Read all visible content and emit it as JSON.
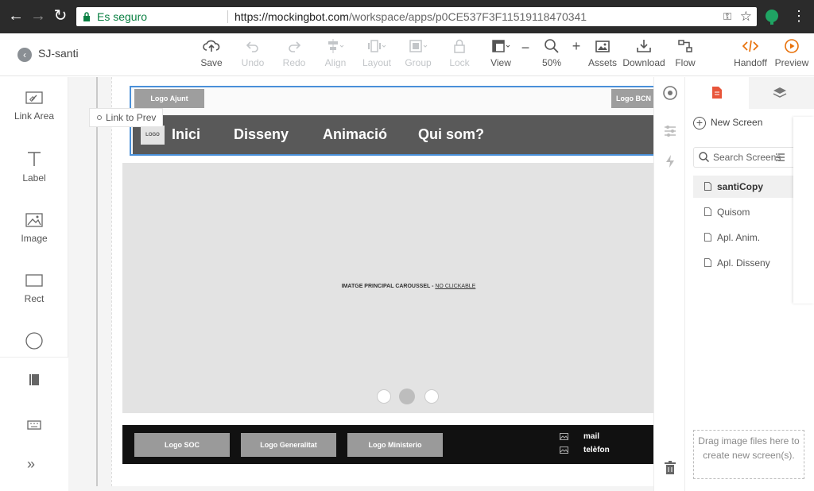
{
  "browser": {
    "secure_label": "Es seguro",
    "url_host": "https://mockingbot.com",
    "url_path": "/workspace/apps/p0CE537F3F11519118470341"
  },
  "toolbar": {
    "project_name": "SJ-santi",
    "save": "Save",
    "undo": "Undo",
    "redo": "Redo",
    "align": "Align",
    "layout": "Layout",
    "group": "Group",
    "lock": "Lock",
    "view": "View",
    "zoom": "50%",
    "assets": "Assets",
    "download": "Download",
    "flow": "Flow",
    "handoff": "Handoff",
    "preview": "Preview"
  },
  "widgets": {
    "link_area": "Link Area",
    "label": "Label",
    "image": "Image",
    "rect": "Rect"
  },
  "canvas": {
    "link_tip": "Link to Prev",
    "logo_ajunt": "Logo Ajunt",
    "logo_bcn": "Logo BCN",
    "logo_small": "LOGO",
    "nav": [
      "Inici",
      "Disseny",
      "Animació",
      "Qui som?"
    ],
    "carousel_text": "IMATGE PRINCIPAL CAROUSSEL - ",
    "carousel_nc": "NO CLICKABLE",
    "footer_logos": [
      "Logo SOC",
      "Logo Generalitat",
      "Logo Ministerio"
    ],
    "contact_mail": "mail",
    "contact_phone": "telèfon"
  },
  "right_panel": {
    "new_screen": "New Screen",
    "search_placeholder": "Search Screens",
    "screens": [
      "santiCopy",
      "Quisom",
      "Apl. Anim.",
      "Apl. Disseny"
    ],
    "active_screen": "santiCopy",
    "drop_text": "Drag image files here to create new screen(s)."
  },
  "colors": {
    "accent": "#4a90d9",
    "handoff": "#e8710a",
    "preview": "#e8710a",
    "navbar": "#595959",
    "footer": "#111111"
  }
}
